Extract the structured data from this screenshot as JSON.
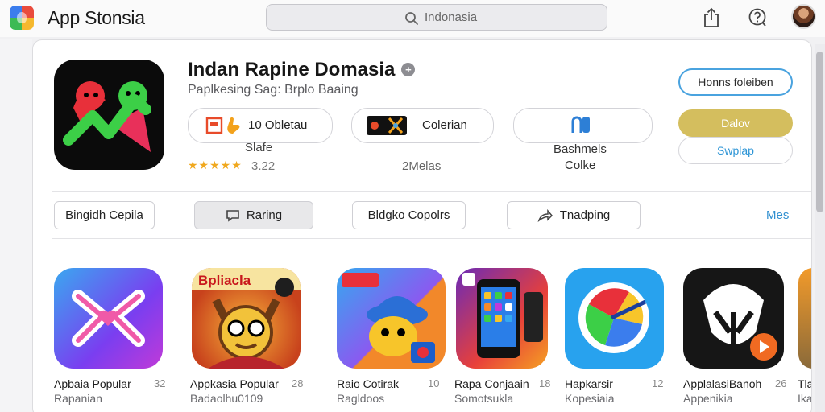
{
  "app": {
    "title": "App Stonsia"
  },
  "search": {
    "query": "Indonasia"
  },
  "toolbar": {
    "share_icon": "share-icon",
    "help_icon": "question-icon"
  },
  "hero": {
    "title": "Indan Rapine Domasia",
    "subtitle": "Paplkesing Sag: Brplo Baaing",
    "pills": [
      {
        "label": "10 Obletau"
      },
      {
        "label": "Colerian"
      },
      {
        "label": ""
      }
    ],
    "meta": [
      "Slafe",
      "3.22",
      "2Melas",
      "Bashmels",
      "Colke"
    ],
    "rating_stars": 5,
    "buttons": {
      "primary": "Honns foleiben",
      "gold": "Dalov",
      "secondary": "Swplap"
    }
  },
  "tabs": [
    {
      "label": "Bingidh Cepila"
    },
    {
      "label": "Raring"
    },
    {
      "label": "Bldgko Copolrs"
    },
    {
      "label": "Tnadping"
    }
  ],
  "tabs_more": "Mes",
  "apps": [
    {
      "name": "Apbaia Popular",
      "count": "32",
      "sub": "Rapanian"
    },
    {
      "name": "Appkasia Popular",
      "count": "28",
      "sub": "Badaolhu0109"
    },
    {
      "name": "Raio Cotirak",
      "count": "10",
      "sub": "Ragldoos"
    },
    {
      "name": "Rapa Conjaain",
      "count": "18",
      "sub": "Somotsukla"
    },
    {
      "name": "Hapkarsir",
      "count": "12",
      "sub": "Kopesiaia"
    },
    {
      "name": "ApplalasiBanoh",
      "count": "26",
      "sub": "Appenikia"
    },
    {
      "name": "Tla",
      "count": "",
      "sub": "Ika"
    }
  ],
  "icon_badge": "Bpliacla"
}
